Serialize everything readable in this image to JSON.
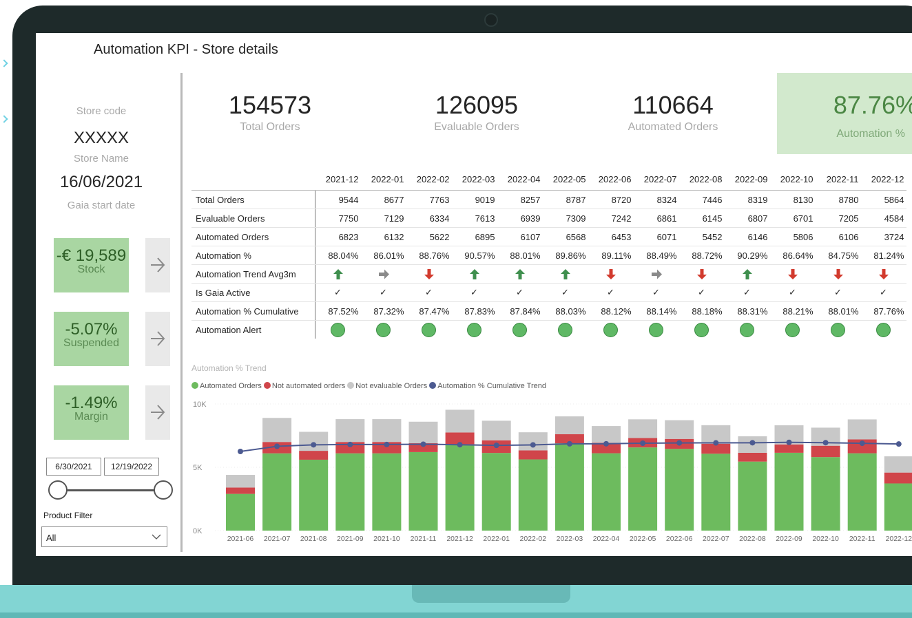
{
  "report": {
    "title": "Automation KPI - Store details"
  },
  "store": {
    "code_label": "Store code",
    "code_value": "XXXXX",
    "name_label": "Store Name",
    "start_date_value": "16/06/2021",
    "start_date_label": "Gaia start date"
  },
  "tiles": [
    {
      "value": "-€ 19,589",
      "caption": "Stock"
    },
    {
      "value": "-5.07%",
      "caption": "Suspended"
    },
    {
      "value": "-1.49%",
      "caption": "Margin"
    }
  ],
  "date_range": {
    "start": "6/30/2021",
    "end": "12/19/2022"
  },
  "product_filter": {
    "label": "Product Filter",
    "value": "All"
  },
  "kpis": [
    {
      "value": "154573",
      "caption": "Total Orders"
    },
    {
      "value": "126095",
      "caption": "Evaluable Orders"
    },
    {
      "value": "110664",
      "caption": "Automated Orders"
    },
    {
      "value": "87.76%",
      "caption": "Automation %"
    }
  ],
  "matrix": {
    "columns": [
      "2021-12",
      "2022-01",
      "2022-02",
      "2022-03",
      "2022-04",
      "2022-05",
      "2022-06",
      "2022-07",
      "2022-08",
      "2022-09",
      "2022-10",
      "2022-11",
      "2022-12"
    ],
    "rows": [
      {
        "label": "Total Orders",
        "values": [
          "9544",
          "8677",
          "7763",
          "9019",
          "8257",
          "8787",
          "8720",
          "8324",
          "7446",
          "8319",
          "8130",
          "8780",
          "5864"
        ]
      },
      {
        "label": "Evaluable Orders",
        "values": [
          "7750",
          "7129",
          "6334",
          "7613",
          "6939",
          "7309",
          "7242",
          "6861",
          "6145",
          "6807",
          "6701",
          "7205",
          "4584"
        ]
      },
      {
        "label": "Automated Orders",
        "values": [
          "6823",
          "6132",
          "5622",
          "6895",
          "6107",
          "6568",
          "6453",
          "6071",
          "5452",
          "6146",
          "5806",
          "6106",
          "3724"
        ]
      },
      {
        "label": "Automation %",
        "values": [
          "88.04%",
          "86.01%",
          "88.76%",
          "90.57%",
          "88.01%",
          "89.86%",
          "89.11%",
          "88.49%",
          "88.72%",
          "90.29%",
          "86.64%",
          "84.75%",
          "81.24%"
        ]
      }
    ],
    "trend_label": "Automation Trend Avg3m",
    "trend": [
      "up",
      "right",
      "down",
      "up",
      "up",
      "up",
      "down",
      "right",
      "down",
      "up",
      "down",
      "down",
      "down"
    ],
    "gaia_label": "Is Gaia Active",
    "gaia_mark": "✓",
    "cumulative": {
      "label": "Automation % Cumulative",
      "values": [
        "87.52%",
        "87.32%",
        "87.47%",
        "87.83%",
        "87.84%",
        "88.03%",
        "88.12%",
        "88.14%",
        "88.18%",
        "88.31%",
        "88.21%",
        "88.01%",
        "87.76%"
      ]
    },
    "alert_label": "Automation Alert",
    "alert_color": "#5fb865",
    "trend_colors": {
      "up": "#3f8f4e",
      "down": "#d23a2d",
      "right": "#8a8a8a"
    }
  },
  "chart": {
    "title": "Automation % Trend",
    "legend": [
      {
        "label": "Automated Orders",
        "color": "#6dbb5e"
      },
      {
        "label": "Not automated orders",
        "color": "#d0454a"
      },
      {
        "label": "Not evaluable Orders",
        "color": "#c8c8c8"
      },
      {
        "label": "Automation % Cumulative Trend",
        "color": "#4c5a91"
      }
    ],
    "y_ticks": [
      "0K",
      "5K",
      "10K"
    ]
  },
  "chart_data": {
    "type": "bar",
    "stacked": true,
    "categories": [
      "2021-06",
      "2021-07",
      "2021-08",
      "2021-09",
      "2021-10",
      "2021-11",
      "2021-12",
      "2022-01",
      "2022-02",
      "2022-03",
      "2022-04",
      "2022-05",
      "2022-06",
      "2022-07",
      "2022-08",
      "2022-09",
      "2022-10",
      "2022-11",
      "2022-12"
    ],
    "series": [
      {
        "name": "Automated Orders",
        "values": [
          2900,
          6100,
          5600,
          6100,
          6100,
          6200,
          6823,
          6132,
          5622,
          6895,
          6107,
          6568,
          6453,
          6071,
          5452,
          6146,
          5806,
          6106,
          3724
        ]
      },
      {
        "name": "Not automated orders",
        "values": [
          500,
          900,
          700,
          900,
          900,
          700,
          927,
          997,
          712,
          718,
          832,
          741,
          789,
          790,
          693,
          661,
          895,
          1099,
          860
        ]
      },
      {
        "name": "Not evaluable Orders",
        "values": [
          1000,
          1900,
          1500,
          1800,
          1800,
          1700,
          1794,
          1548,
          1429,
          1406,
          1318,
          1478,
          1478,
          1463,
          1301,
          1512,
          1429,
          1575,
          1280
        ]
      }
    ],
    "line": {
      "name": "Automation % Cumulative Trend",
      "values": [
        85.3,
        87.0,
        87.5,
        87.6,
        87.6,
        87.7,
        87.52,
        87.32,
        87.47,
        87.83,
        87.84,
        88.03,
        88.12,
        88.14,
        88.18,
        88.31,
        88.21,
        88.01,
        87.76
      ]
    },
    "ylim": [
      0,
      10000
    ]
  }
}
